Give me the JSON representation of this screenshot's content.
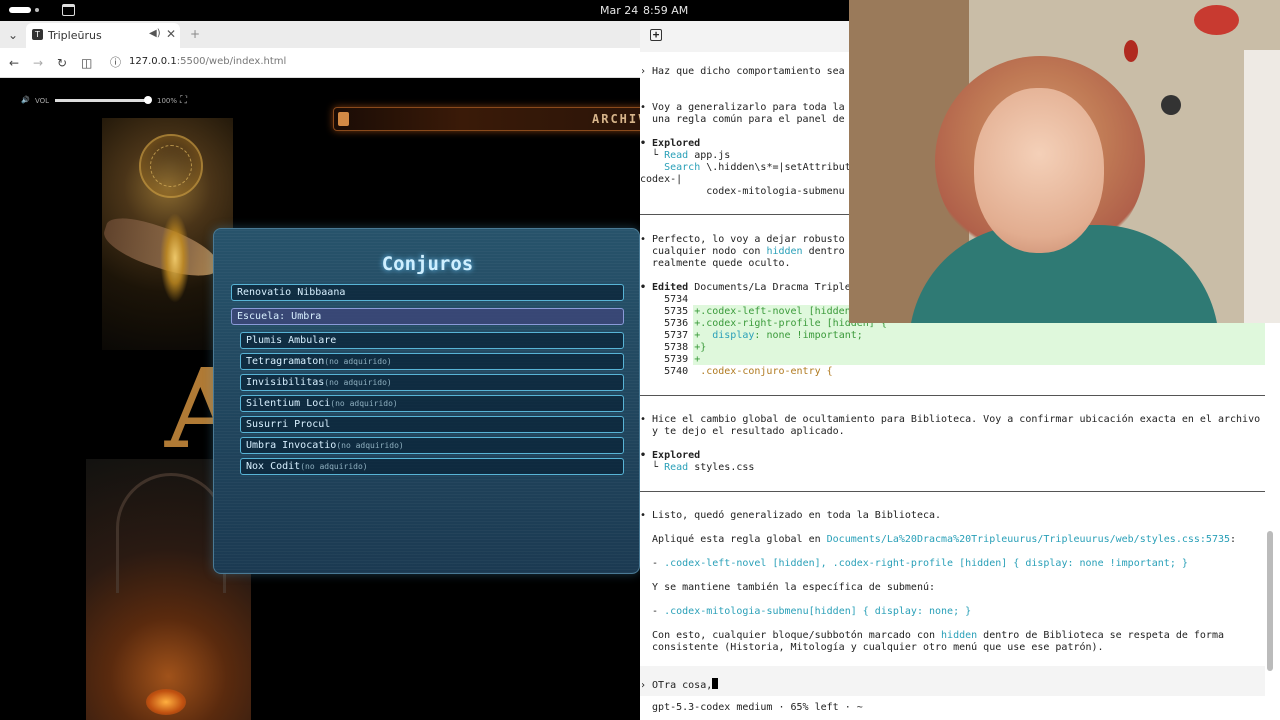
{
  "topbar": {
    "date": "Mar 24",
    "time": "8:59 AM"
  },
  "browser": {
    "tab_title": "Tripleūrus",
    "tab_favicon": "T",
    "url_host": "127.0.0.1",
    "url_path": ":5500/web/index.html"
  },
  "page": {
    "vol_label": "VOL",
    "vol_value": "100%",
    "archive_label": "ARCHIV",
    "panel_title": "Conjuros",
    "entries": [
      {
        "name": "Renovatio Nibbaana",
        "note": "",
        "indent": false,
        "selected": false
      },
      {
        "name": "Escuela: Umbra",
        "note": "",
        "indent": false,
        "selected": true
      },
      {
        "name": "Plumis Ambulare",
        "note": "",
        "indent": true,
        "selected": false
      },
      {
        "name": "Tetragramaton",
        "note": "(no adquirido)",
        "indent": true,
        "selected": false
      },
      {
        "name": "Invisibilitas",
        "note": "(no adquirido)",
        "indent": true,
        "selected": false
      },
      {
        "name": "Silentium Loci",
        "note": "(no adquirido)",
        "indent": true,
        "selected": false
      },
      {
        "name": "Susurri Procul",
        "note": "",
        "indent": true,
        "selected": false
      },
      {
        "name": "Umbra Invocatio",
        "note": "(no adquirido)",
        "indent": true,
        "selected": false
      },
      {
        "name": "Nox Codit",
        "note": "(no adquirido)",
        "indent": true,
        "selected": false
      }
    ]
  },
  "terminal": {
    "l1": "› Haz que dicho comportamiento sea",
    "l2": "• Voy a generalizarlo para toda la",
    "l3": "  una regla común para el panel de",
    "l4": "• Explored",
    "l5a": "  └ ",
    "l5b": "Read",
    "l5c": " app.js",
    "l6a": "    ",
    "l6b": "Search",
    "l6c": " \\.hidden\\s*=|setAttribut",
    "l7": "codex-|",
    "l8": "           codex-mitologia-submenu",
    "l9": "• Perfecto, lo voy a dejar robusto",
    "l10": "  cualquier nodo con ",
    "l10b": "hidden",
    "l10c": " dentro",
    "l11": "  realmente quede oculto.",
    "l12a": "• Edited",
    "l12b": " Documents/La Dracma Triple",
    "d1": "    5734",
    "d2n": "    5735 ",
    "d2": "+.codex-left-novel [hidden",
    "d3n": "    5736 ",
    "d3": "+.codex-right-profile [hidden] {",
    "d4n": "    5737 ",
    "d4a": "+  ",
    "d4b": "display",
    "d4c": ": none !important;",
    "d5n": "    5738 ",
    "d5": "+}",
    "d6n": "    5739 ",
    "d6": "+",
    "d7n": "    5740 ",
    "d7": " .codex-conjuro-entry {",
    "m1": "• Hice el cambio global de ocultamiento para Biblioteca. Voy a confirmar ubicación exacta en el archivo",
    "m2": "  y te dejo el resultado aplicado.",
    "e1": "• Explored",
    "e2a": "  └ ",
    "e2b": "Read",
    "e2c": " styles.css",
    "r1": "• Listo, quedó generalizado en toda la Biblioteca.",
    "r2a": "  Apliqué esta regla global en ",
    "r2b": "Documents/La%20Dracma%20Tripleuurus/Tripleuurus/web/styles.css:5735",
    "r2c": ":",
    "r3a": "  - ",
    "r3b": ".codex-left-novel [hidden], .codex-right-profile [hidden] { display: none !important; }",
    "r4": "  Y se mantiene también la específica de submenú:",
    "r5a": "  - ",
    "r5b": ".codex-mitologia-submenu[hidden] { display: none; }",
    "r6a": "  Con esto, cualquier bloque/subbotón marcado con ",
    "r6b": "hidden",
    "r6c": " dentro de Biblioteca se respeta de forma",
    "r7": "  consistente (Historia, Mitología y cualquier otro menú que use ese patrón).",
    "input": "› OTra cosa,",
    "status": "  gpt-5.3-codex medium · 65% left · ~"
  },
  "colors": {
    "accent_cyan": "#2aa0b8",
    "diff_green_bg": "#dff8dc",
    "panel_border": "#58b4d6"
  }
}
